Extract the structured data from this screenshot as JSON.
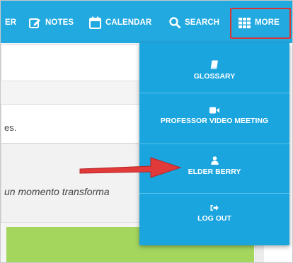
{
  "nav": {
    "truncated_label": "ER",
    "notes_label": "NOTES",
    "calendar_label": "CALENDAR",
    "search_label": "SEARCH",
    "more_label": "MORE"
  },
  "content": {
    "line_fragment": "es.",
    "italic_fragment": "un momento transforma"
  },
  "more_menu": {
    "items": [
      {
        "label": "GLOSSARY",
        "icon": "book-icon"
      },
      {
        "label": "PROFESSOR VIDEO MEETING",
        "icon": "video-camera-icon"
      },
      {
        "label": "ELDER BERRY",
        "icon": "user-icon"
      },
      {
        "label": "LOG OUT",
        "icon": "sign-out-icon"
      }
    ]
  },
  "colors": {
    "nav_blue": "#22a9e0",
    "dropdown_blue": "#1aa5df",
    "highlight_red": "#d73535",
    "accent_green": "#a4d65e"
  }
}
